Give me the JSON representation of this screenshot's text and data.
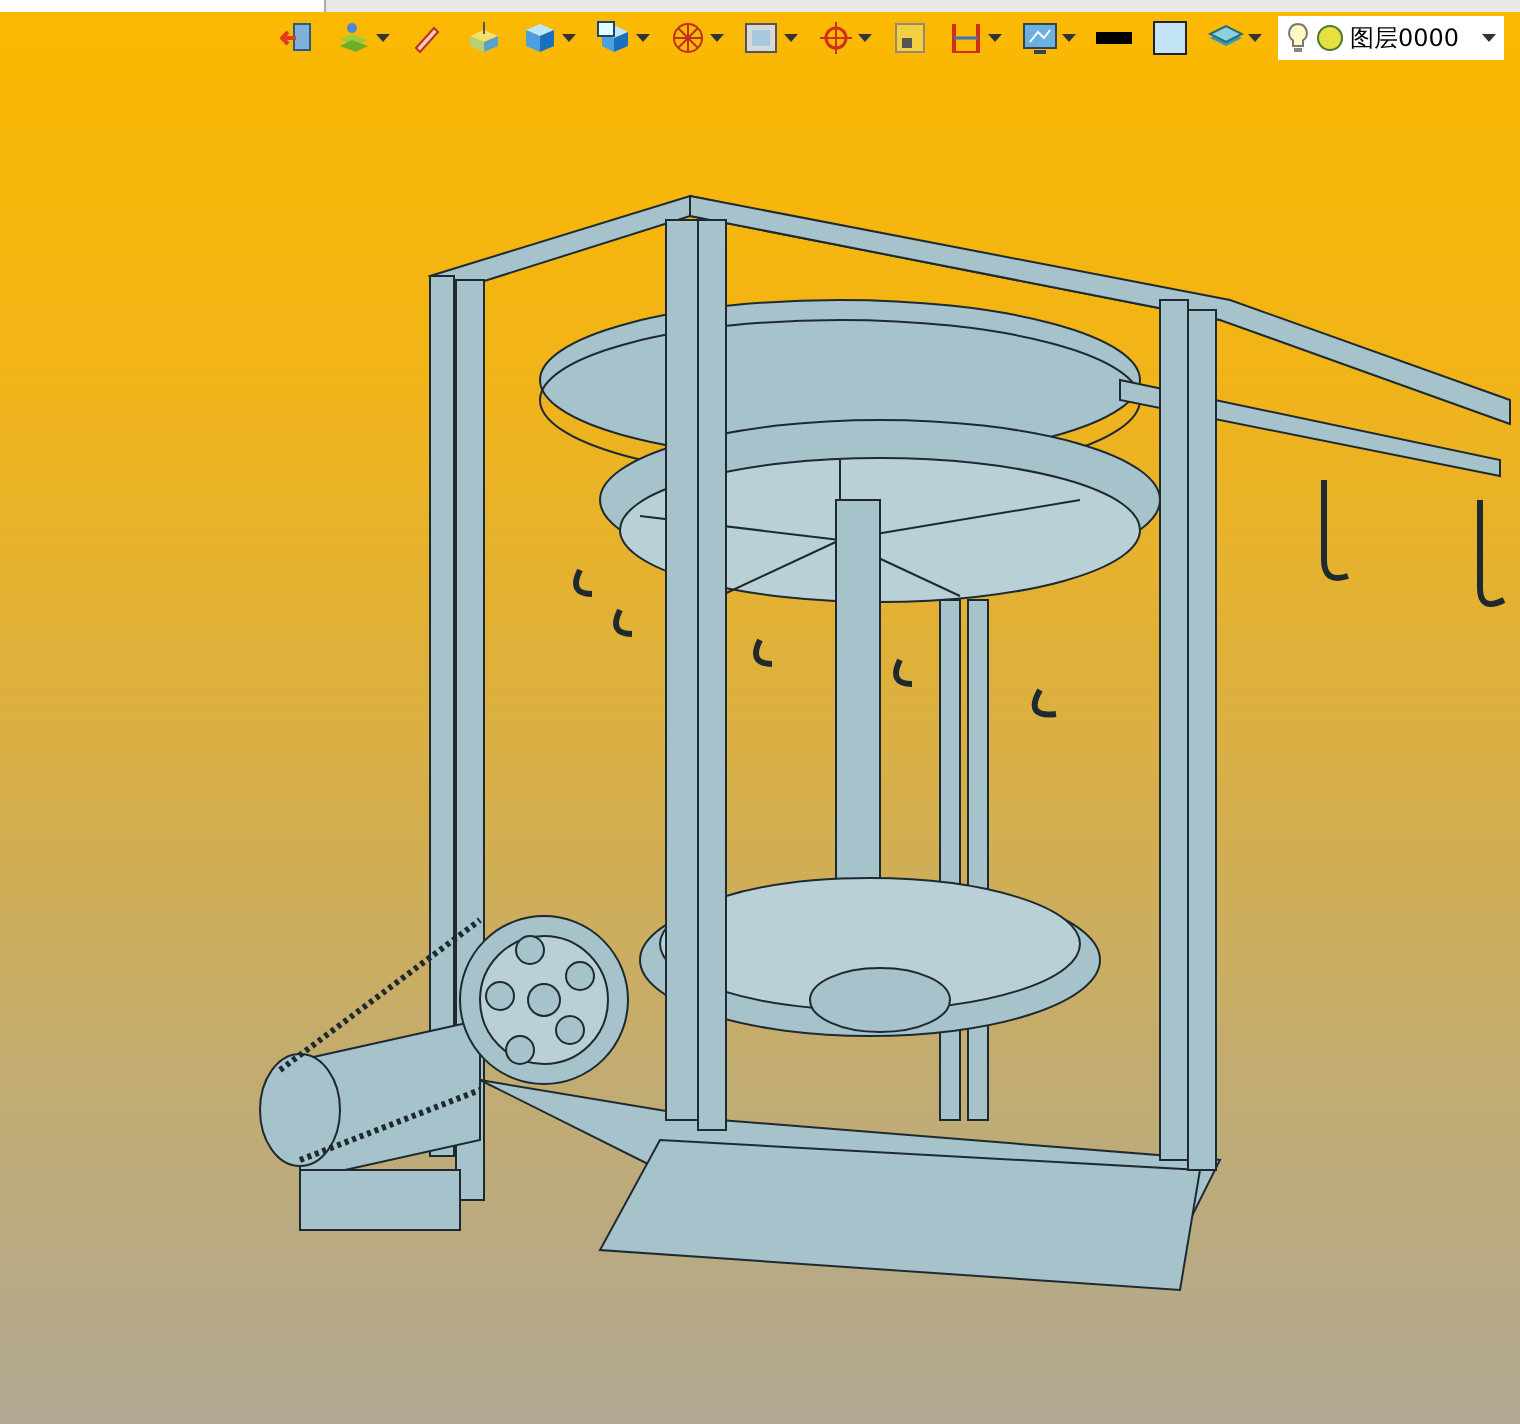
{
  "toolbar": {
    "items": [
      {
        "kind": "exit",
        "dropdown": false
      },
      {
        "kind": "layers",
        "dropdown": true
      },
      {
        "kind": "pen",
        "dropdown": false
      },
      {
        "kind": "box",
        "dropdown": false
      },
      {
        "kind": "cube",
        "dropdown": true
      },
      {
        "kind": "view",
        "dropdown": true
      },
      {
        "kind": "sphere",
        "dropdown": true
      },
      {
        "kind": "frame",
        "dropdown": true
      },
      {
        "kind": "target",
        "dropdown": true
      },
      {
        "kind": "small",
        "dropdown": false
      },
      {
        "kind": "dimension",
        "dropdown": true
      },
      {
        "kind": "monitor",
        "dropdown": true
      },
      {
        "kind": "line",
        "dropdown": false
      },
      {
        "kind": "color",
        "dropdown": false
      },
      {
        "kind": "stack",
        "dropdown": true
      }
    ]
  },
  "layer_select": {
    "value": "图层0000",
    "visible": true
  }
}
